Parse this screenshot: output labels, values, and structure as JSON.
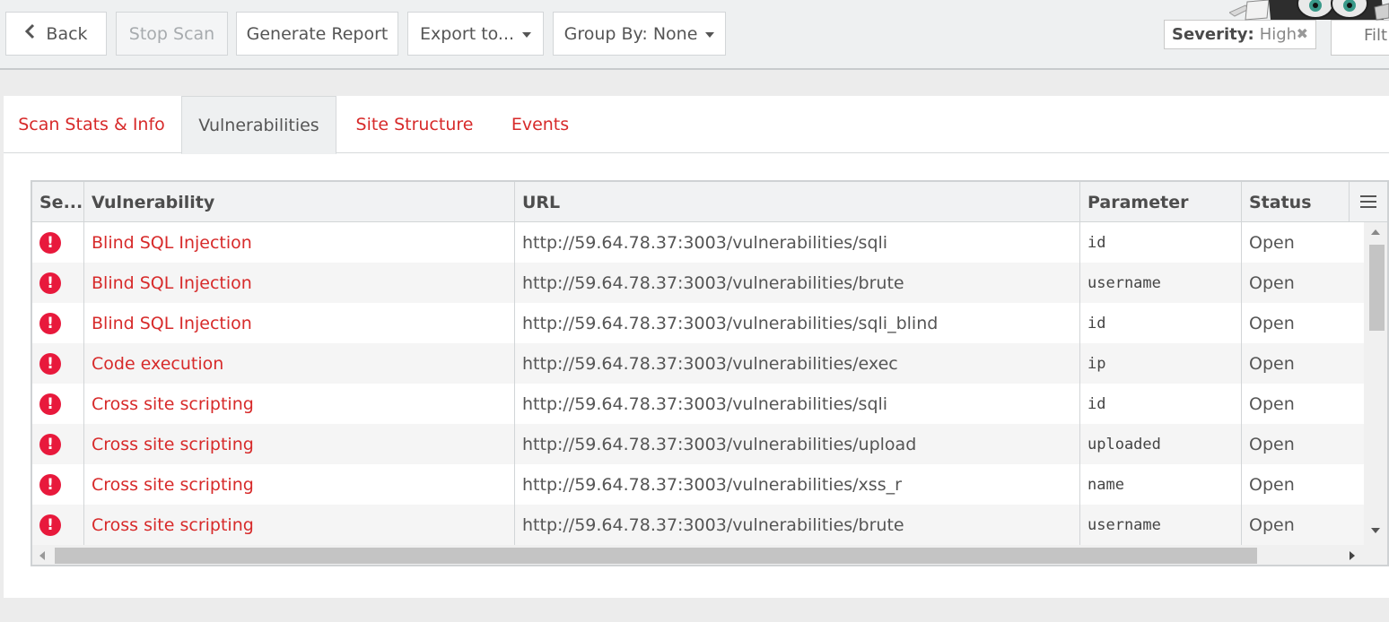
{
  "toolbar": {
    "back_label": "Back",
    "stop_scan_label": "Stop Scan",
    "generate_report_label": "Generate Report",
    "export_label": "Export to...",
    "group_by_label": "Group By: None",
    "severity_filter": {
      "label": "Severity:",
      "value": "High"
    },
    "filter_label": "Filt"
  },
  "tabs": [
    {
      "label": "Scan Stats & Info",
      "active": false
    },
    {
      "label": "Vulnerabilities",
      "active": true
    },
    {
      "label": "Site Structure",
      "active": false
    },
    {
      "label": "Events",
      "active": false
    }
  ],
  "grid": {
    "columns": [
      "Se...",
      "Vulnerability",
      "URL",
      "Parameter",
      "Status"
    ],
    "rows": [
      {
        "severity": "high",
        "vulnerability": "Blind SQL Injection",
        "url": "http://59.64.78.37:3003/vulnerabilities/sqli",
        "parameter": "id",
        "status": "Open"
      },
      {
        "severity": "high",
        "vulnerability": "Blind SQL Injection",
        "url": "http://59.64.78.37:3003/vulnerabilities/brute",
        "parameter": "username",
        "status": "Open"
      },
      {
        "severity": "high",
        "vulnerability": "Blind SQL Injection",
        "url": "http://59.64.78.37:3003/vulnerabilities/sqli_blind",
        "parameter": "id",
        "status": "Open"
      },
      {
        "severity": "high",
        "vulnerability": "Code execution",
        "url": "http://59.64.78.37:3003/vulnerabilities/exec",
        "parameter": "ip",
        "status": "Open"
      },
      {
        "severity": "high",
        "vulnerability": "Cross site scripting",
        "url": "http://59.64.78.37:3003/vulnerabilities/sqli",
        "parameter": "id",
        "status": "Open"
      },
      {
        "severity": "high",
        "vulnerability": "Cross site scripting",
        "url": "http://59.64.78.37:3003/vulnerabilities/upload",
        "parameter": "uploaded",
        "status": "Open"
      },
      {
        "severity": "high",
        "vulnerability": "Cross site scripting",
        "url": "http://59.64.78.37:3003/vulnerabilities/xss_r",
        "parameter": "name",
        "status": "Open"
      },
      {
        "severity": "high",
        "vulnerability": "Cross site scripting",
        "url": "http://59.64.78.37:3003/vulnerabilities/brute",
        "parameter": "username",
        "status": "Open"
      }
    ]
  },
  "icons": {
    "back": "chevron-left-icon",
    "severity_high": "exclamation-circle-icon",
    "column_menu": "hamburger-menu-icon",
    "clear_filter": "close-icon"
  },
  "colors": {
    "accent_red": "#d72a2a",
    "severity_high": "#e8193c"
  }
}
